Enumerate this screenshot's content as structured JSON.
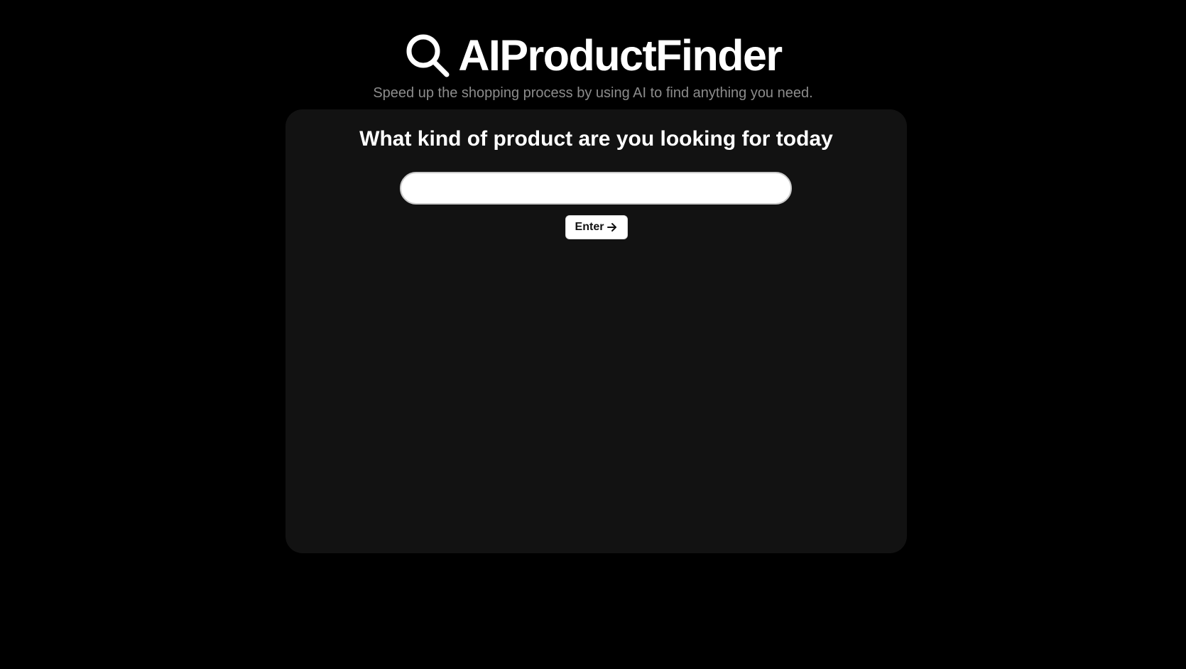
{
  "header": {
    "title": "AIProductFinder",
    "subtitle": "Speed up the shopping process by using AI to find anything you need.",
    "logo_icon": "search-icon"
  },
  "search": {
    "heading": "What kind of product are you looking for today",
    "value": "",
    "placeholder": "",
    "button_label": "Enter",
    "button_icon": "arrow-right-icon"
  },
  "colors": {
    "background": "#000000",
    "card": "#121212",
    "subtitle": "#8c8c8c",
    "text": "#ffffff"
  }
}
